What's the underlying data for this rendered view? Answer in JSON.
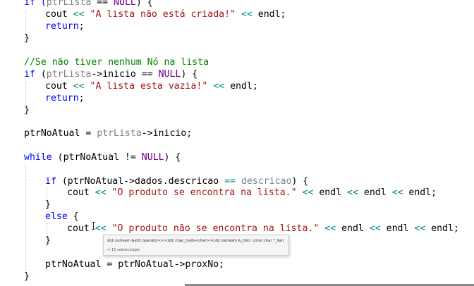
{
  "code": {
    "line1": {
      "t1": "if (",
      "t2": "ptrLista",
      "t3": " == ",
      "t4": "NULL",
      "t5": ") {"
    },
    "line2": {
      "t1": "cout ",
      "t2": "<<",
      "t3": " ",
      "t4": "\"A lista não está criada!\"",
      "t5": " ",
      "t6": "<<",
      "t7": " endl;"
    },
    "line3": {
      "t1": "return",
      "t2": ";"
    },
    "line4": {
      "t1": "}"
    },
    "line5": {
      "t1": "//Se não tiver nenhum Nó na lista"
    },
    "line6": {
      "t1": "if",
      "t2": " (",
      "t3": "ptrLista",
      "t4": "->inicio == ",
      "t5": "NULL",
      "t6": ") {"
    },
    "line7": {
      "t1": "cout ",
      "t2": "<<",
      "t3": " ",
      "t4": "\"A lista esta vazia!\"",
      "t5": " ",
      "t6": "<<",
      "t7": " endl;"
    },
    "line8": {
      "t1": "return",
      "t2": ";"
    },
    "line9": {
      "t1": "}"
    },
    "line10": {
      "t1": "ptrNoAtual = ",
      "t2": "ptrLista",
      "t3": "->inicio;"
    },
    "line11": {
      "t1": "while",
      "t2": " (ptrNoAtual != ",
      "t3": "NULL",
      "t4": ") {"
    },
    "line12": {
      "t1": "if",
      "t2": " (ptrNoAtual->dados.descricao ",
      "t3": "==",
      "t4": " ",
      "t5": "descricao",
      "t6": ") {"
    },
    "line13": {
      "t1": "cout ",
      "t2": "<<",
      "t3": " ",
      "t4": "\"O produto se encontra na lista.\"",
      "t5": " ",
      "t6": "<<",
      "t7": " endl ",
      "t8": "<<",
      "t9": " endl ",
      "t10": "<<",
      "t11": " endl;"
    },
    "line14": {
      "t1": "}"
    },
    "line15": {
      "t1": "else",
      "t2": " {"
    },
    "line16": {
      "t1": "cout ",
      "t2": "<<",
      "t3": " ",
      "t4": "\"O produto não se encontra na lista.\"",
      "t5": " ",
      "t6": "<<",
      "t7": " endl ",
      "t8": "<<",
      "t9": " endl ",
      "t10": "<<",
      "t11": " endl;"
    },
    "line17": {
      "t1": "}"
    },
    "line18": {
      "t1": "ptrNoAtual = ptrNoAtual->proxNo;"
    },
    "line19": {
      "t1": "}"
    }
  },
  "tooltip": {
    "signature": "std::ostream &std::operator<<<std::char_traits<char>>(std::ostream &_Ostr, const char *_Val)",
    "overloads": "+ 15 sobrecargas"
  },
  "colors": {
    "keyword": "#0000ff",
    "string": "#a31515",
    "comment": "#008000",
    "parameter": "#808080",
    "operator": "#008080",
    "macro": "#6f008a"
  }
}
